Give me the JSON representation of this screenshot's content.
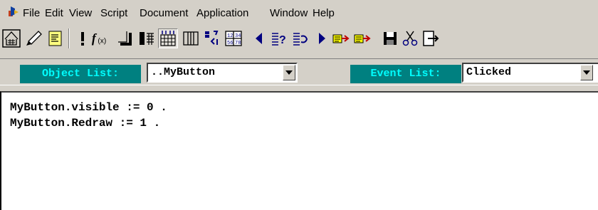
{
  "menu": {
    "items": [
      "File",
      "Edit",
      "View",
      "Script",
      "Document",
      "Application",
      "Window",
      "Help"
    ]
  },
  "toolbar": {
    "icons": [
      "form-painter-icon",
      "paint-brush-icon",
      "script-icon",
      "debug-stop-icon",
      "function-icon",
      "shadow-icon",
      "column-left-icon",
      "column-right-icon",
      "column-book-icon",
      "tab-order-icon",
      "grid-icon",
      "previous-icon",
      "lookup-icon",
      "browse-icon",
      "next-icon",
      "paste-function-icon",
      "paste-statement-icon",
      "save-icon",
      "cut-icon",
      "exit-icon"
    ]
  },
  "object_list": {
    "label": "Object List:",
    "value": "..MyButton"
  },
  "event_list": {
    "label": "Event List:",
    "value": "Clicked"
  },
  "editor": {
    "lines": [
      "MyButton.visible := 0 .",
      "MyButton.Redraw := 1 ."
    ]
  },
  "colors": {
    "window_bg": "#d4d0c8",
    "label_bg": "#008080",
    "label_text": "#00ffff",
    "editor_bg": "#ffffff"
  }
}
